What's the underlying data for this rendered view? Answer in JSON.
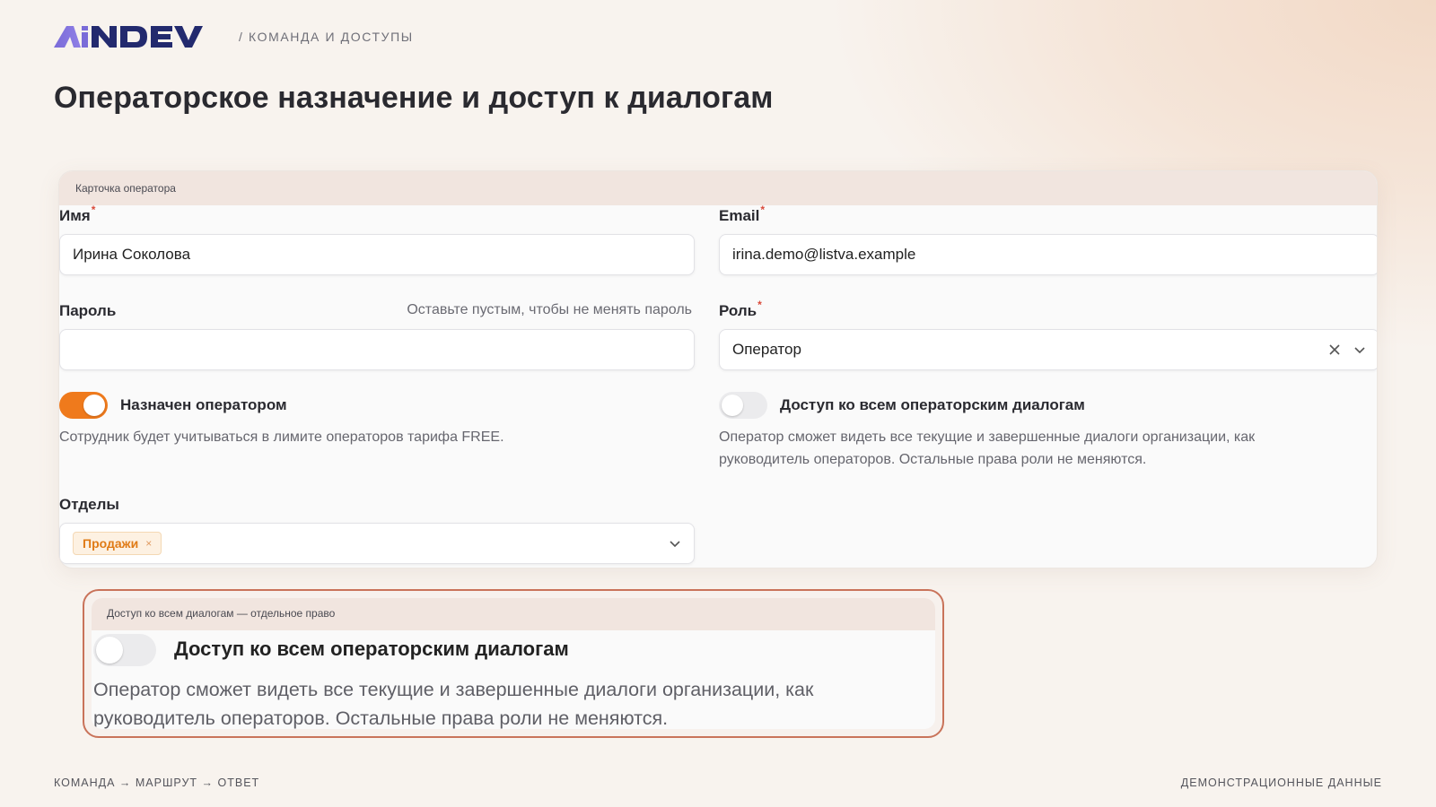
{
  "header": {
    "logo_text": "AiNDEV",
    "breadcrumb": "/ КОМАНДА И ДОСТУПЫ"
  },
  "page_title": "Операторское назначение и доступ к диалогам",
  "card": {
    "header": "Карточка оператора",
    "name": {
      "label": "Имя",
      "value": "Ирина Соколова",
      "required": true
    },
    "email": {
      "label": "Email",
      "value": "irina.demo@listva.example",
      "required": true
    },
    "password": {
      "label": "Пароль",
      "hint": "Оставьте пустым, чтобы не менять пароль",
      "value": ""
    },
    "role": {
      "label": "Роль",
      "value": "Оператор",
      "required": true
    },
    "assigned_toggle": {
      "label": "Назначен оператором",
      "state": "on",
      "description": "Сотрудник будет учитываться в лимите операторов тарифа FREE."
    },
    "all_dialogs_toggle": {
      "label": "Доступ ко всем операторским диалогам",
      "state": "off",
      "description_line1": "Оператор сможет видеть все текущие и завершенные диалоги организации, как",
      "description_line2": "руководитель операторов. Остальные права роли не меняются."
    },
    "departments": {
      "label": "Отделы",
      "tags": [
        "Продажи"
      ]
    }
  },
  "callout": {
    "header": "Доступ ко всем диалогам — отдельное право",
    "label": "Доступ ко всем операторским диалогам",
    "state": "off",
    "description_line1": "Оператор сможет видеть все текущие и завершенные диалоги организации, как",
    "description_line2": "руководитель операторов. Остальные права роли не меняются."
  },
  "footer": {
    "left": "КОМАНДА → МАРШРУТ → ОТВЕТ",
    "right": "ДЕМОНСТРАЦИОННЫЕ ДАННЫЕ"
  },
  "colors": {
    "accent_orange": "#ef7a1c",
    "logo_purple": "#7a6bd8",
    "callout_border": "#c9735a",
    "required_red": "#d94a3a"
  }
}
